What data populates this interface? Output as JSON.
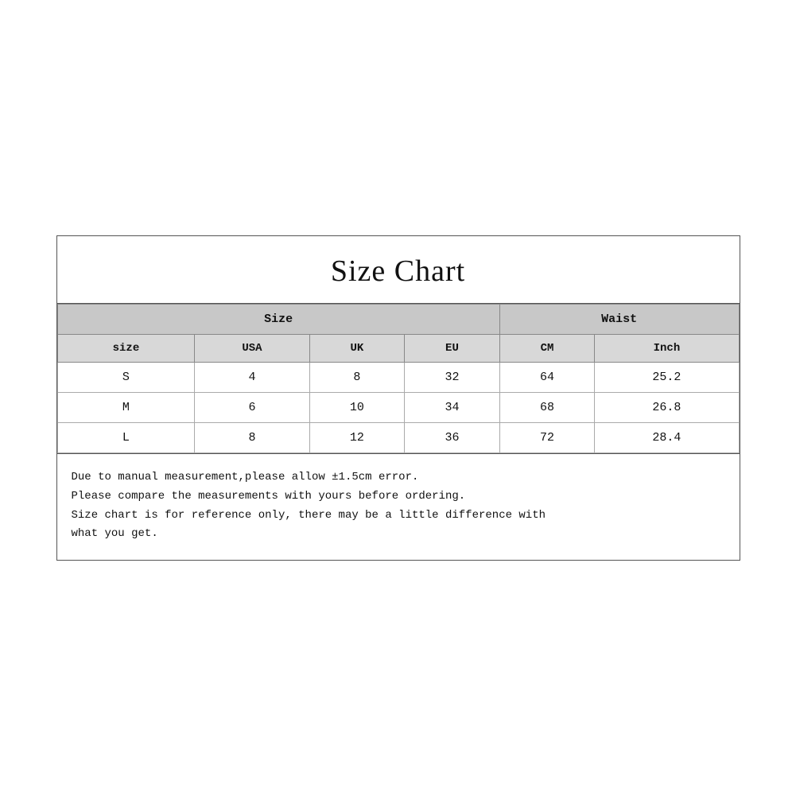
{
  "title": "Size Chart",
  "table": {
    "header_row1": [
      {
        "label": "Size",
        "colspan": 4
      },
      {
        "label": "Waist",
        "colspan": 2
      }
    ],
    "header_row2": [
      {
        "label": "size"
      },
      {
        "label": "USA"
      },
      {
        "label": "UK"
      },
      {
        "label": "EU"
      },
      {
        "label": "CM"
      },
      {
        "label": "Inch"
      }
    ],
    "rows": [
      {
        "size": "S",
        "usa": "4",
        "uk": "8",
        "eu": "32",
        "cm": "64",
        "inch": "25.2"
      },
      {
        "size": "M",
        "usa": "6",
        "uk": "10",
        "eu": "34",
        "cm": "68",
        "inch": "26.8"
      },
      {
        "size": "L",
        "usa": "8",
        "uk": "12",
        "eu": "36",
        "cm": "72",
        "inch": "28.4"
      }
    ]
  },
  "notes": "Due to manual measurement,please allow ±1.5cm error.\nPlease compare the measurements with yours before ordering.\nSize chart is for reference only, there may be a little difference with\nwhat you get."
}
